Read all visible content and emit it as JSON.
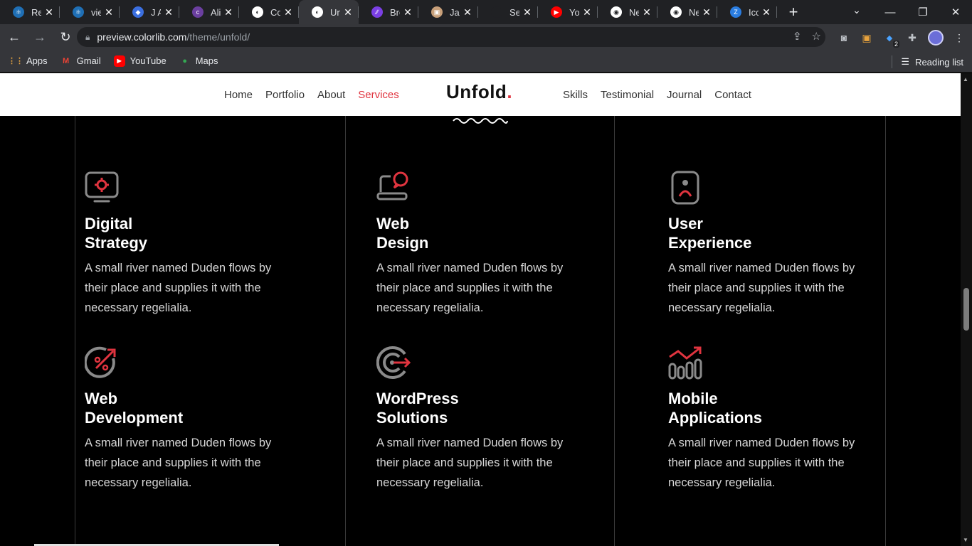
{
  "browser": {
    "tabs": [
      {
        "title": "Rea",
        "color": "#1f6fb5",
        "glyph": "⚛"
      },
      {
        "title": "view",
        "color": "#1f6fb5",
        "glyph": "⚛"
      },
      {
        "title": "J A",
        "color": "#3b6fe0",
        "glyph": "◆"
      },
      {
        "title": "Alin",
        "color": "#6b3fa0",
        "glyph": "c"
      },
      {
        "title": "Colo",
        "color": "#fff",
        "glyph": "◐"
      },
      {
        "title": "Unfo",
        "color": "#fff",
        "glyph": "◐"
      },
      {
        "title": "Bre",
        "color": "#7b3fe4",
        "glyph": "∕∕"
      },
      {
        "title": "Jam",
        "color": "#c8a07a",
        "glyph": "▣"
      },
      {
        "title": "Setti",
        "color": "#202124",
        "glyph": ""
      },
      {
        "title": "You",
        "color": "#ff0000",
        "glyph": "▶"
      },
      {
        "title": "Nev",
        "color": "#fff",
        "glyph": "◉"
      },
      {
        "title": "Nev",
        "color": "#fff",
        "glyph": "◉"
      },
      {
        "title": "Icor",
        "color": "#2a7de1",
        "glyph": "Z"
      }
    ],
    "active_tab_index": 5,
    "new_tab_symbol": "+",
    "url_host": "preview.colorlib.com",
    "url_path": "/theme/unfold/",
    "extension_badge": "2",
    "bookmarks": [
      {
        "label": "Apps",
        "icon": "apps-grid-icon"
      },
      {
        "label": "Gmail",
        "icon": "gmail-icon"
      },
      {
        "label": "YouTube",
        "icon": "youtube-icon"
      },
      {
        "label": "Maps",
        "icon": "maps-pin-icon"
      }
    ],
    "reading_list": "Reading list"
  },
  "site": {
    "nav_left": [
      "Home",
      "Portfolio",
      "About",
      "Services"
    ],
    "nav_right": [
      "Skills",
      "Testimonial",
      "Journal",
      "Contact"
    ],
    "active_nav": "Services",
    "logo_text": "Unfold",
    "logo_dot": ".",
    "accent_color": "#e0343f",
    "services": [
      {
        "title_line1": "Digital",
        "title_line2": "Strategy",
        "icon": "monitor-gear-icon",
        "desc": "A small river named Duden flows by their place and supplies it with the necessary regelialia."
      },
      {
        "title_line1": "Web",
        "title_line2": "Design",
        "icon": "laptop-chat-icon",
        "desc": "A small river named Duden flows by their place and supplies it with the necessary regelialia."
      },
      {
        "title_line1": "User",
        "title_line2": "Experience",
        "icon": "user-profile-icon",
        "desc": "A small river named Duden flows by their place and supplies it with the necessary regelialia."
      },
      {
        "title_line1": "Web",
        "title_line2": "Development",
        "icon": "percent-arrow-icon",
        "desc": "A small river named Duden flows by their place and supplies it with the necessary regelialia."
      },
      {
        "title_line1": "WordPress",
        "title_line2": "Solutions",
        "icon": "target-arrow-icon",
        "desc": "A small river named Duden flows by their place and supplies it with the necessary regelialia."
      },
      {
        "title_line1": "Mobile",
        "title_line2": "Applications",
        "icon": "growth-chart-icon",
        "desc": "A small river named Duden flows by their place and supplies it with the necessary regelialia."
      }
    ]
  }
}
